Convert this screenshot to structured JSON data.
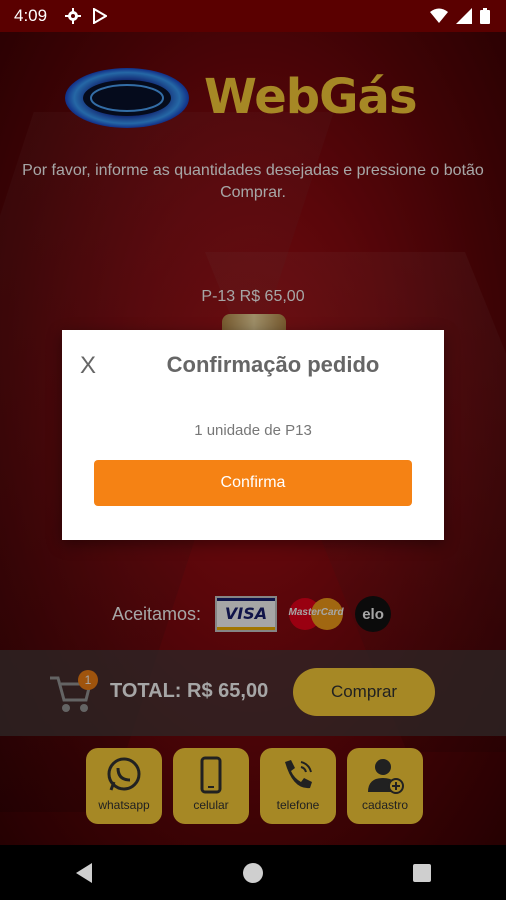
{
  "status_bar": {
    "time": "4:09"
  },
  "brand": {
    "name": "WebGás"
  },
  "instruction": "Por favor, informe as quantidades desejadas e pressione o botão Comprar.",
  "product": {
    "label": "P-13 R$ 65,00"
  },
  "dialog": {
    "close_label": "X",
    "title": "Confirmação pedido",
    "message": "1 unidade de P13",
    "confirm_label": "Confirma"
  },
  "payment": {
    "label": "Aceitamos:",
    "cards": [
      {
        "name": "VISA"
      },
      {
        "name": "MasterCard"
      },
      {
        "name": "elo"
      }
    ]
  },
  "cart": {
    "count": "1"
  },
  "total": {
    "text": "TOTAL: R$ 65,00"
  },
  "buy_label": "Comprar",
  "contacts": [
    {
      "label": "whatsapp",
      "icon": "whatsapp-icon"
    },
    {
      "label": "celular",
      "icon": "mobile-phone-icon"
    },
    {
      "label": "telefone",
      "icon": "phone-icon"
    },
    {
      "label": "cadastro",
      "icon": "add-user-icon"
    }
  ],
  "colors": {
    "accent_yellow": "#ffd23a",
    "confirm_orange": "#f58214",
    "background_red": "#8a0a10"
  }
}
